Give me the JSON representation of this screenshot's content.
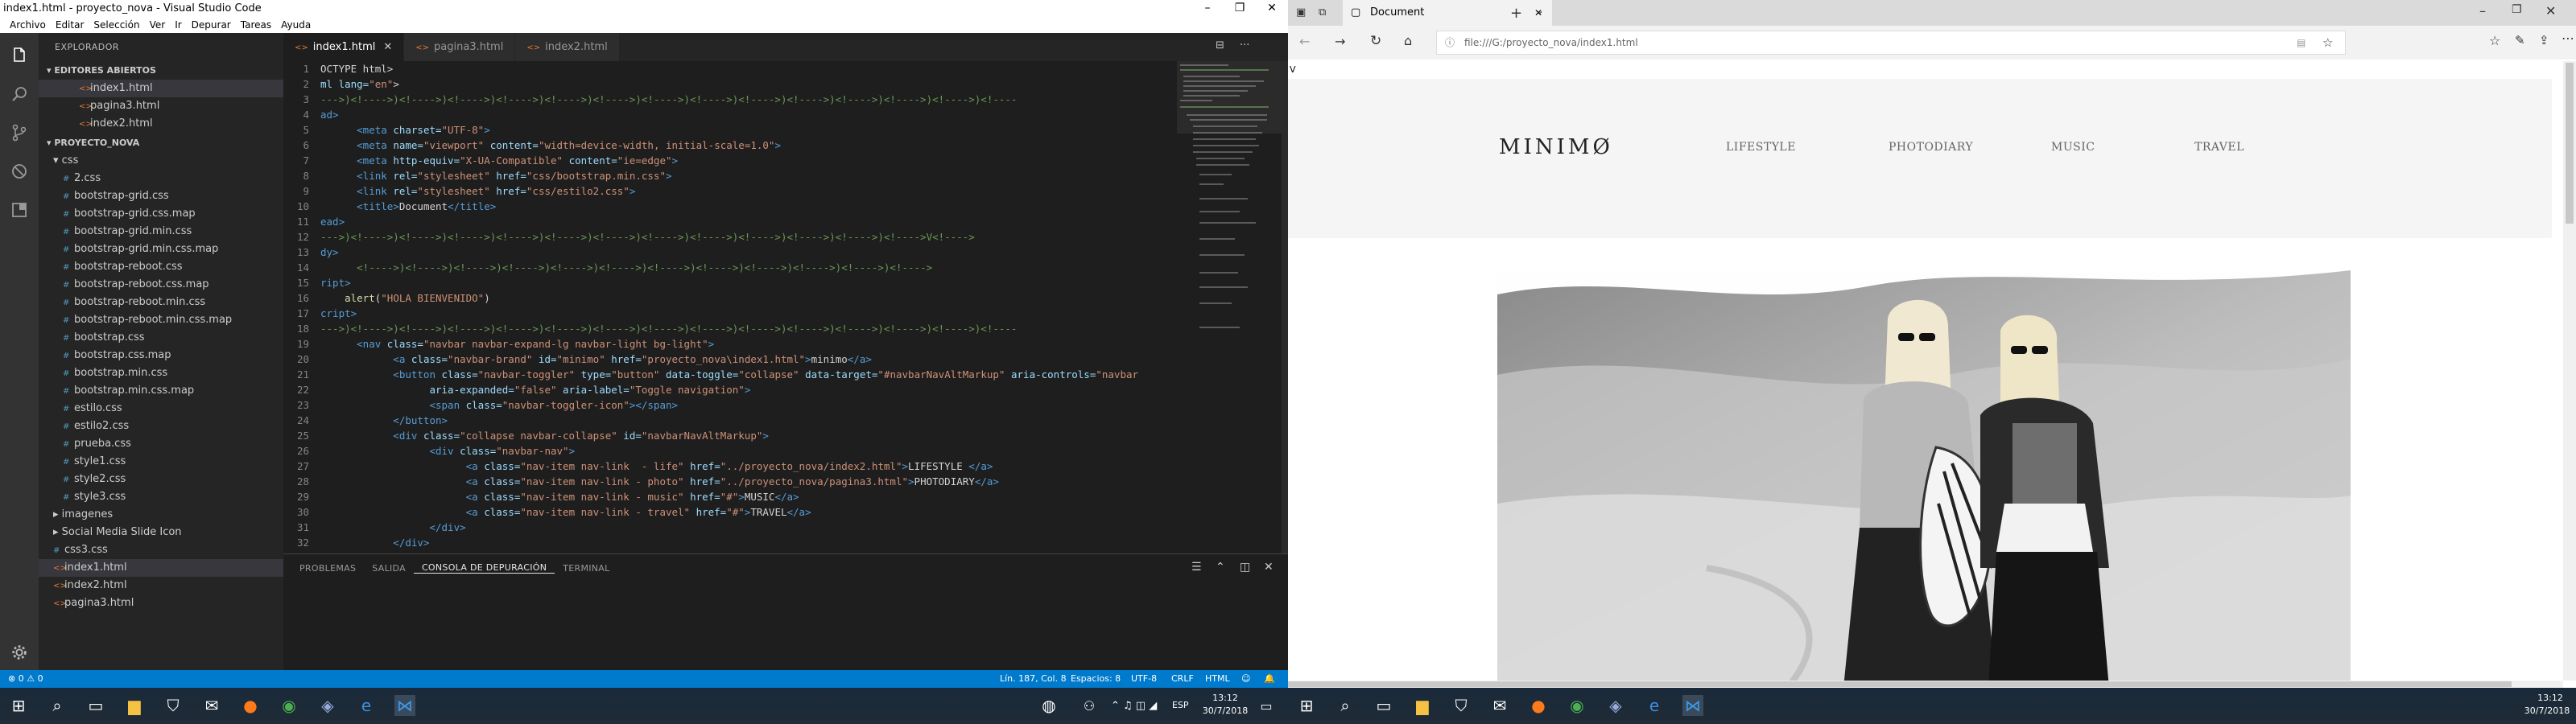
{
  "vscode": {
    "window_title": "index1.html - proyecto_nova - Visual Studio Code",
    "menu": [
      "Archivo",
      "Editar",
      "Selección",
      "Ver",
      "Ir",
      "Depurar",
      "Tareas",
      "Ayuda"
    ],
    "explorer_title": "EXPLORADOR",
    "open_editors_title": "▾ EDITORES ABIERTOS",
    "open_editors": [
      "index1.html",
      "pagina3.html",
      "index2.html"
    ],
    "project_title": "▾ PROYECTO_NOVA",
    "tree": [
      {
        "label": "▾ css",
        "indent": 1,
        "kind": "folder"
      },
      {
        "label": "2.css",
        "indent": 2,
        "kind": "css"
      },
      {
        "label": "bootstrap-grid.css",
        "indent": 2,
        "kind": "css"
      },
      {
        "label": "bootstrap-grid.css.map",
        "indent": 2,
        "kind": "css"
      },
      {
        "label": "bootstrap-grid.min.css",
        "indent": 2,
        "kind": "css"
      },
      {
        "label": "bootstrap-grid.min.css.map",
        "indent": 2,
        "kind": "css"
      },
      {
        "label": "bootstrap-reboot.css",
        "indent": 2,
        "kind": "css"
      },
      {
        "label": "bootstrap-reboot.css.map",
        "indent": 2,
        "kind": "css"
      },
      {
        "label": "bootstrap-reboot.min.css",
        "indent": 2,
        "kind": "css"
      },
      {
        "label": "bootstrap-reboot.min.css.map",
        "indent": 2,
        "kind": "css"
      },
      {
        "label": "bootstrap.css",
        "indent": 2,
        "kind": "css"
      },
      {
        "label": "bootstrap.css.map",
        "indent": 2,
        "kind": "css"
      },
      {
        "label": "bootstrap.min.css",
        "indent": 2,
        "kind": "css"
      },
      {
        "label": "bootstrap.min.css.map",
        "indent": 2,
        "kind": "css"
      },
      {
        "label": "estilo.css",
        "indent": 2,
        "kind": "css"
      },
      {
        "label": "estilo2.css",
        "indent": 2,
        "kind": "css"
      },
      {
        "label": "prueba.css",
        "indent": 2,
        "kind": "css"
      },
      {
        "label": "style1.css",
        "indent": 2,
        "kind": "css"
      },
      {
        "label": "style2.css",
        "indent": 2,
        "kind": "css"
      },
      {
        "label": "style3.css",
        "indent": 2,
        "kind": "css"
      },
      {
        "label": "▸ imagenes",
        "indent": 1,
        "kind": "folder"
      },
      {
        "label": "▸ Social Media Slide Icon",
        "indent": 1,
        "kind": "folder"
      },
      {
        "label": "css3.css",
        "indent": 1,
        "kind": "css"
      },
      {
        "label": "index1.html",
        "indent": 1,
        "kind": "html",
        "selected": true
      },
      {
        "label": "index2.html",
        "indent": 1,
        "kind": "html"
      },
      {
        "label": "pagina3.html",
        "indent": 1,
        "kind": "html"
      }
    ],
    "tabs": [
      {
        "label": "index1.html",
        "active": true
      },
      {
        "label": "pagina3.html",
        "active": false
      },
      {
        "label": "index2.html",
        "active": false
      }
    ],
    "code_lines": [
      [
        "1",
        [
          [
            "",
            "OCTYPE html>"
          ]
        ]
      ],
      [
        "2",
        [
          [
            "c-attr",
            "ml lang="
          ],
          [
            "c-str",
            "\"en\""
          ],
          [
            "",
            "> "
          ]
        ]
      ],
      [
        "3",
        [
          [
            "c-com",
            "--->)<!---->)<!---->)<!---->)<!---->)<!---->)<!---->)<!---->)<!---->)<!---->)<!---->)<!---->)<!---->)<!---->)<!----"
          ]
        ]
      ],
      [
        "4",
        [
          [
            "c-tag",
            "ad>"
          ]
        ]
      ],
      [
        "5",
        [
          [
            "c-tag",
            "      <meta "
          ],
          [
            "c-attr",
            "charset="
          ],
          [
            "c-str",
            "\"UTF-8\""
          ],
          [
            "c-tag",
            ">"
          ]
        ]
      ],
      [
        "6",
        [
          [
            "c-tag",
            "      <meta "
          ],
          [
            "c-attr",
            "name="
          ],
          [
            "c-str",
            "\"viewport\""
          ],
          [
            "c-attr",
            " content="
          ],
          [
            "c-str",
            "\"width=device-width, initial-scale=1.0\""
          ],
          [
            "c-tag",
            ">"
          ]
        ]
      ],
      [
        "7",
        [
          [
            "c-tag",
            "      <meta "
          ],
          [
            "c-attr",
            "http-equiv="
          ],
          [
            "c-str",
            "\"X-UA-Compatible\""
          ],
          [
            "c-attr",
            " content="
          ],
          [
            "c-str",
            "\"ie=edge\""
          ],
          [
            "c-tag",
            ">"
          ]
        ]
      ],
      [
        "8",
        [
          [
            "c-tag",
            "      <link "
          ],
          [
            "c-attr",
            "rel="
          ],
          [
            "c-str",
            "\"stylesheet\""
          ],
          [
            "c-attr",
            " href="
          ],
          [
            "c-str",
            "\"css/bootstrap.min.css\""
          ],
          [
            "c-tag",
            ">"
          ]
        ]
      ],
      [
        "9",
        [
          [
            "c-tag",
            "      <link "
          ],
          [
            "c-attr",
            "rel="
          ],
          [
            "c-str",
            "\"stylesheet\""
          ],
          [
            "c-attr",
            " href="
          ],
          [
            "c-str",
            "\"css/estilo2.css\""
          ],
          [
            "c-tag",
            ">"
          ]
        ]
      ],
      [
        "10",
        [
          [
            "c-tag",
            "      <title>"
          ],
          [
            "",
            "Document"
          ],
          [
            "c-tag",
            "</title>"
          ]
        ]
      ],
      [
        "11",
        [
          [
            "c-tag",
            "ead>"
          ]
        ]
      ],
      [
        "12",
        [
          [
            "c-com",
            "--->)<!---->)<!---->)<!---->)<!---->)<!---->)<!---->)<!---->)<!---->)<!---->)<!---->)<!---->)<!---->V<!---->"
          ]
        ]
      ],
      [
        "13",
        [
          [
            "c-tag",
            "dy>"
          ]
        ]
      ],
      [
        "14",
        [
          [
            "c-com",
            "      <!---->)<!---->)<!---->)<!---->)<!---->)<!---->)<!---->)<!---->)<!---->)<!---->)<!---->)<!---->"
          ]
        ]
      ],
      [
        "15",
        [
          [
            "c-tag",
            "ript>"
          ]
        ]
      ],
      [
        "16",
        [
          [
            "c-fn",
            "    alert"
          ],
          [
            "",
            "("
          ],
          [
            "c-str",
            "\"HOLA BIENVENIDO\""
          ],
          [
            "",
            ")"
          ]
        ]
      ],
      [
        "17",
        [
          [
            "c-tag",
            "cript>"
          ]
        ]
      ],
      [
        "18",
        [
          [
            "c-com",
            "--->)<!---->)<!---->)<!---->)<!---->)<!---->)<!---->)<!---->)<!---->)<!---->)<!---->)<!---->)<!---->)<!---->)<!----"
          ]
        ]
      ],
      [
        "19",
        [
          [
            "c-tag",
            "      <nav "
          ],
          [
            "c-attr",
            "class="
          ],
          [
            "c-str",
            "\"navbar navbar-expand-lg navbar-light bg-light\""
          ],
          [
            "c-tag",
            ">"
          ]
        ]
      ],
      [
        "20",
        [
          [
            "c-tag",
            "            <a "
          ],
          [
            "c-attr",
            "class="
          ],
          [
            "c-str",
            "\"navbar-brand\""
          ],
          [
            "c-attr",
            " id="
          ],
          [
            "c-str",
            "\"minimo\""
          ],
          [
            "c-attr",
            " href="
          ],
          [
            "c-str",
            "\"proyecto_nova\\index1.html\""
          ],
          [
            "c-tag",
            ">"
          ],
          [
            "",
            "minimo"
          ],
          [
            "c-tag",
            "</a>"
          ]
        ]
      ],
      [
        "21",
        [
          [
            "c-tag",
            "            <button "
          ],
          [
            "c-attr",
            "class="
          ],
          [
            "c-str",
            "\"navbar-toggler\""
          ],
          [
            "c-attr",
            " type="
          ],
          [
            "c-str",
            "\"button\""
          ],
          [
            "c-attr",
            " data-toggle="
          ],
          [
            "c-str",
            "\"collapse\""
          ],
          [
            "c-attr",
            " data-target="
          ],
          [
            "c-str",
            "\"#navbarNavAltMarkup\""
          ],
          [
            "c-attr",
            " aria-controls="
          ],
          [
            "c-str",
            "\"navbar"
          ]
        ]
      ],
      [
        "22",
        [
          [
            "c-attr",
            "                  aria-expanded="
          ],
          [
            "c-str",
            "\"false\""
          ],
          [
            "c-attr",
            " aria-label="
          ],
          [
            "c-str",
            "\"Toggle navigation\""
          ],
          [
            "c-tag",
            ">"
          ]
        ]
      ],
      [
        "23",
        [
          [
            "c-tag",
            "                  <span "
          ],
          [
            "c-attr",
            "class="
          ],
          [
            "c-str",
            "\"navbar-toggler-icon\""
          ],
          [
            "c-tag",
            "></span>"
          ]
        ]
      ],
      [
        "24",
        [
          [
            "c-tag",
            "            </button>"
          ]
        ]
      ],
      [
        "25",
        [
          [
            "c-tag",
            "            <div "
          ],
          [
            "c-attr",
            "class="
          ],
          [
            "c-str",
            "\"collapse navbar-collapse\""
          ],
          [
            "c-attr",
            " id="
          ],
          [
            "c-str",
            "\"navbarNavAltMarkup\""
          ],
          [
            "c-tag",
            ">"
          ]
        ]
      ],
      [
        "26",
        [
          [
            "c-tag",
            "                  <div "
          ],
          [
            "c-attr",
            "class="
          ],
          [
            "c-str",
            "\"navbar-nav\""
          ],
          [
            "c-tag",
            ">"
          ]
        ]
      ],
      [
        "27",
        [
          [
            "c-tag",
            "                        <a "
          ],
          [
            "c-attr",
            "class="
          ],
          [
            "c-str",
            "\"nav-item nav-link  - life\""
          ],
          [
            "c-attr",
            " href="
          ],
          [
            "c-str",
            "\"../proyecto_nova/index2.html\""
          ],
          [
            "c-tag",
            ">"
          ],
          [
            "",
            "LIFESTYLE "
          ],
          [
            "c-tag",
            "</a>"
          ]
        ]
      ],
      [
        "28",
        [
          [
            "c-tag",
            "                        <a "
          ],
          [
            "c-attr",
            "class="
          ],
          [
            "c-str",
            "\"nav-item nav-link - photo\""
          ],
          [
            "c-attr",
            " href="
          ],
          [
            "c-str",
            "\"../proyecto_nova/pagina3.html\""
          ],
          [
            "c-tag",
            ">"
          ],
          [
            "",
            "PHOTODIARY"
          ],
          [
            "c-tag",
            "</a>"
          ]
        ]
      ],
      [
        "29",
        [
          [
            "c-tag",
            "                        <a "
          ],
          [
            "c-attr",
            "class="
          ],
          [
            "c-str",
            "\"nav-item nav-link - music\""
          ],
          [
            "c-attr",
            " href="
          ],
          [
            "c-str",
            "\"#\""
          ],
          [
            "c-tag",
            ">"
          ],
          [
            "",
            "MUSIC"
          ],
          [
            "c-tag",
            "</a>"
          ]
        ]
      ],
      [
        "30",
        [
          [
            "c-tag",
            "                        <a "
          ],
          [
            "c-attr",
            "class="
          ],
          [
            "c-str",
            "\"nav-item nav-link - travel\""
          ],
          [
            "c-attr",
            " href="
          ],
          [
            "c-str",
            "\"#\""
          ],
          [
            "c-tag",
            ">"
          ],
          [
            "",
            "TRAVEL"
          ],
          [
            "c-tag",
            "</a>"
          ]
        ]
      ],
      [
        "31",
        [
          [
            "c-tag",
            "                  </div>"
          ]
        ]
      ],
      [
        "32",
        [
          [
            "c-tag",
            "            </div>"
          ]
        ]
      ]
    ],
    "panel_tabs": [
      "PROBLEMAS",
      "SALIDA",
      "CONSOLA DE DEPURACIÓN",
      "TERMINAL"
    ],
    "panel_active": "CONSOLA DE DEPURACIÓN",
    "panel_prompt": ">",
    "status_left": "⊗ 0  ⚠ 0",
    "status_items": [
      "Lín. 187, Col. 8",
      "Espacios: 8",
      "UTF-8",
      "CRLF",
      "HTML",
      "☺",
      "🔔"
    ]
  },
  "browser": {
    "tab_title": "Document",
    "address": "file:///G:/proyecto_nova/index1.html",
    "page_stray_char": "V",
    "site_logo": "MINIMØ",
    "site_nav": [
      "LIFESTYLE",
      "PHOTODIARY",
      "MUSIC",
      "TRAVEL"
    ]
  },
  "taskbar": {
    "clock_left_time": "13:12",
    "clock_left_date": "30/7/2018",
    "lang_left": "ESP",
    "clock_right_time": "13:12",
    "clock_right_date": "30/7/2018"
  },
  "colors": {
    "vscode_bg": "#1e1e1e",
    "status_blue": "#007acc",
    "sidebar_bg": "#252526",
    "browser_bg": "#ffffff"
  }
}
